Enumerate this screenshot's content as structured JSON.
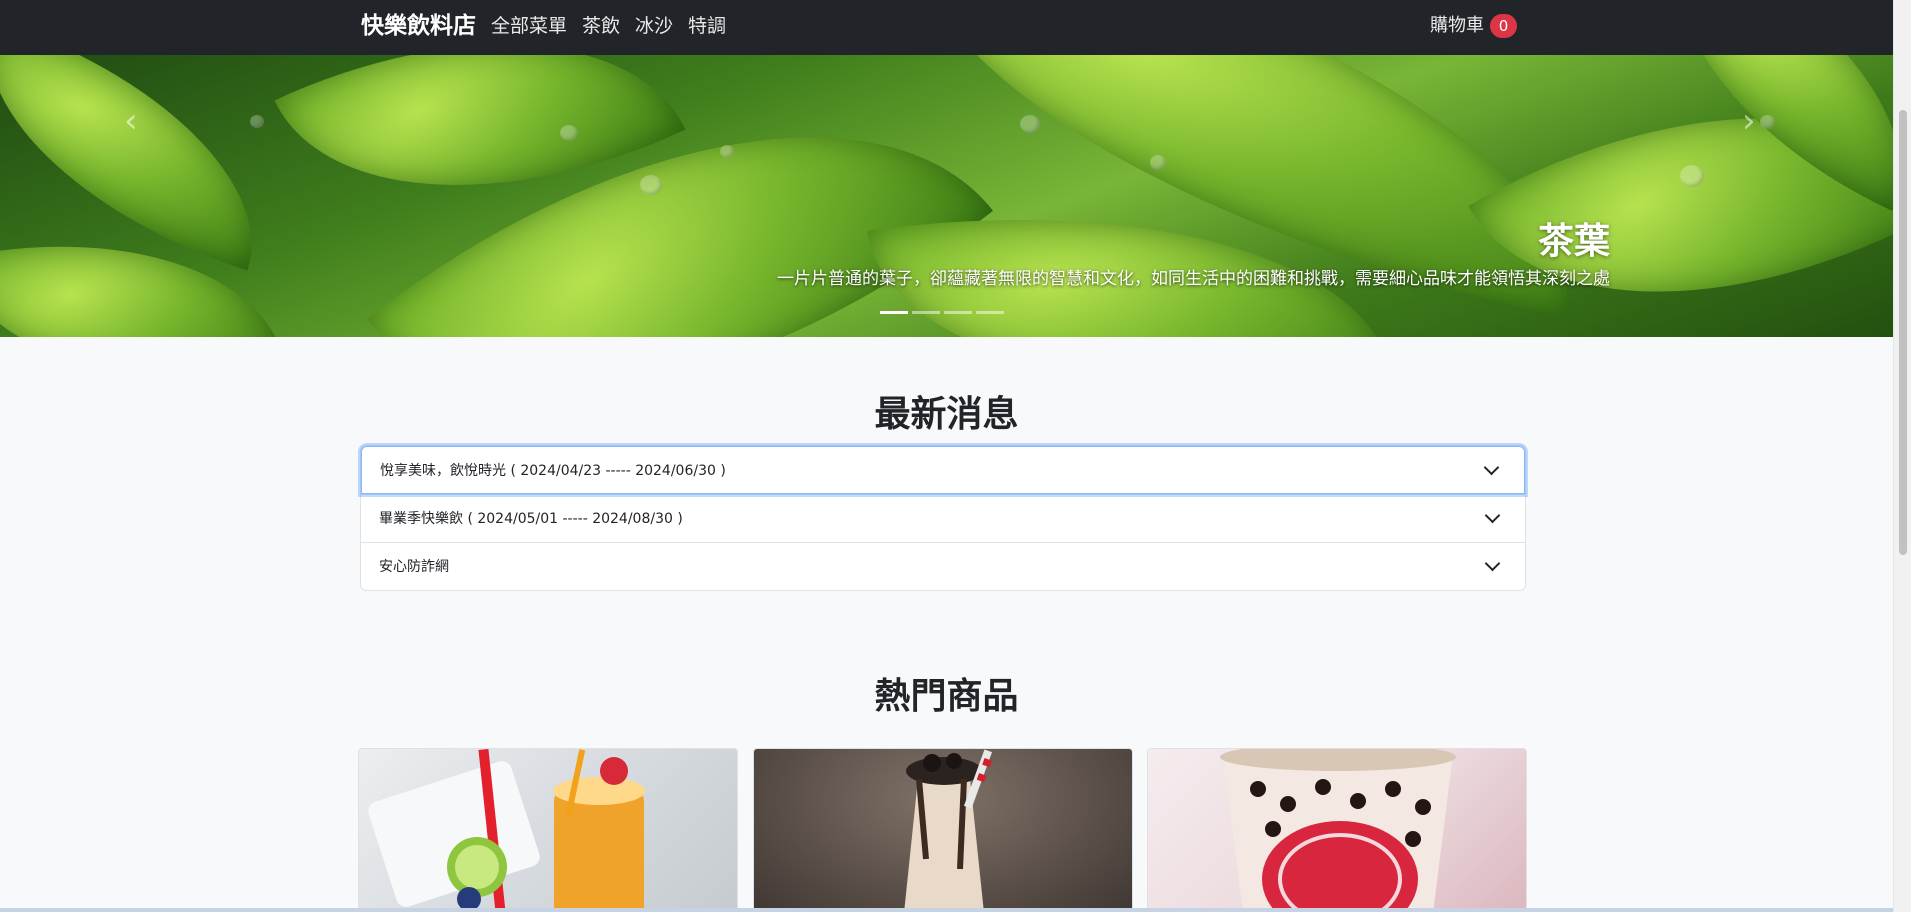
{
  "navbar": {
    "brand": "快樂飲料店",
    "links": [
      "全部菜單",
      "茶飲",
      "冰沙",
      "特調"
    ],
    "cart_label": "購物車",
    "cart_count": "0",
    "colors": {
      "background": "#212529",
      "badge": "#dc3545"
    }
  },
  "carousel": {
    "prev_icon": "‹",
    "next_icon": "›",
    "title": "茶葉",
    "text": "一片片普通的葉子，卻蘊藏著無限的智慧和文化，如同生活中的困難和挑戰，需要細心品味才能領悟其深刻之處",
    "active_slide": 1,
    "slide_count": 4
  },
  "news": {
    "heading": "最新消息",
    "items": [
      {
        "label": "悅享美味，飲悅時光 ( 2024/04/23 ----- 2024/06/30 )"
      },
      {
        "label": "畢業季快樂飲 ( 2024/05/01 ----- 2024/08/30 )"
      },
      {
        "label": "安心防詐網"
      }
    ]
  },
  "products": {
    "heading": "熱門商品"
  }
}
